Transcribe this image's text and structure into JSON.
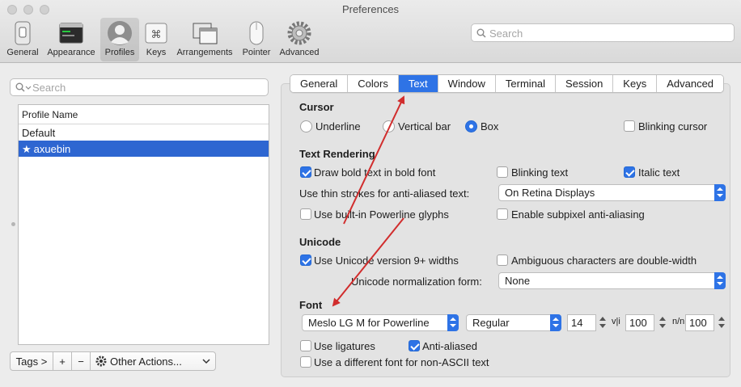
{
  "window": {
    "title": "Preferences"
  },
  "toolbar": {
    "items": [
      {
        "label": "General"
      },
      {
        "label": "Appearance"
      },
      {
        "label": "Profiles"
      },
      {
        "label": "Keys"
      },
      {
        "label": "Arrangements"
      },
      {
        "label": "Pointer"
      },
      {
        "label": "Advanced"
      }
    ],
    "search_placeholder": "Search"
  },
  "profiles": {
    "search_placeholder": "Search",
    "column_header": "Profile Name",
    "rows": [
      "Default",
      "axuebin"
    ],
    "tags_label": "Tags >",
    "add_label": "+",
    "remove_label": "−",
    "other_actions_label": "Other Actions..."
  },
  "tabs": [
    "General",
    "Colors",
    "Text",
    "Window",
    "Terminal",
    "Session",
    "Keys",
    "Advanced"
  ],
  "cursor": {
    "title": "Cursor",
    "underline": "Underline",
    "vertical_bar": "Vertical bar",
    "box": "Box",
    "blinking": "Blinking cursor"
  },
  "rendering": {
    "title": "Text Rendering",
    "bold": "Draw bold text in bold font",
    "blinking_text": "Blinking text",
    "italic": "Italic text",
    "thin_label": "Use thin strokes for anti-aliased text:",
    "thin_value": "On Retina Displays",
    "powerline": "Use built-in Powerline glyphs",
    "subpixel": "Enable subpixel anti-aliasing"
  },
  "unicode": {
    "title": "Unicode",
    "widths": "Use Unicode version 9+ widths",
    "ambiguous": "Ambiguous characters are double-width",
    "norm_label": "Unicode normalization form:",
    "norm_value": "None"
  },
  "font": {
    "title": "Font",
    "family": "Meslo LG M for Powerline",
    "style": "Regular",
    "size": "14",
    "hspace_icon": "v|i",
    "hspace": "100",
    "vspace_icon": "n/n",
    "vspace": "100",
    "ligatures": "Use ligatures",
    "anti_aliased": "Anti-aliased",
    "non_ascii": "Use a different font for non-ASCII text"
  },
  "colors": {
    "accent": "#2e73e6",
    "selection": "#2e66d1",
    "annotation": "#d12d2d"
  }
}
